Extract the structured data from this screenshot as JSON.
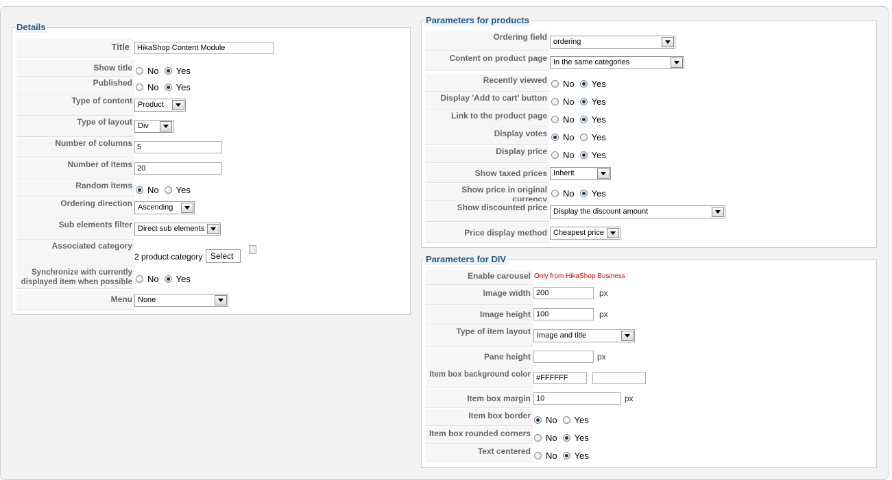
{
  "details": {
    "legend": "Details",
    "title_label": "Title",
    "title_value": "HikaShop Content Module",
    "show_title_label": "Show title",
    "published_label": "Published",
    "type_content_label": "Type of content",
    "type_content_value": "Product",
    "type_layout_label": "Type of layout",
    "type_layout_value": "Div",
    "num_columns_label": "Number of columns",
    "num_columns_value": "5",
    "num_items_label": "Number of items",
    "num_items_value": "20",
    "random_label": "Random items",
    "ordering_dir_label": "Ordering direction",
    "ordering_dir_value": "Ascending",
    "sub_filter_label": "Sub elements filter",
    "sub_filter_value": "Direct sub elements",
    "assoc_cat_label": "Associated category",
    "assoc_cat_value": "2 product category",
    "select_btn": "Select",
    "sync_label": "Synchronize with currently displayed item when possible",
    "menu_label": "Menu",
    "menu_value": "None"
  },
  "radio": {
    "no": "No",
    "yes": "Yes"
  },
  "products": {
    "legend": "Parameters for products",
    "ordering_field_label": "Ordering field",
    "ordering_field_value": "ordering",
    "content_page_label": "Content on product page",
    "content_page_value": "In the same categories",
    "recently_viewed_label": "Recently viewed",
    "add_cart_label": "Display 'Add to cart' button",
    "link_product_label": "Link to the product page",
    "votes_label": "Display votes",
    "price_label": "Display price",
    "taxed_label": "Show taxed prices",
    "taxed_value": "Inherit",
    "orig_currency_label": "Show price in original currency",
    "discounted_label": "Show discounted price",
    "discounted_value": "Display the discount amount",
    "price_method_label": "Price display method",
    "price_method_value": "Cheapest price"
  },
  "div": {
    "legend": "Parameters for DIV",
    "carousel_label": "Enable carousel",
    "carousel_note": "Only from HikaShop Business",
    "img_width_label": "Image width",
    "img_width_value": "200",
    "img_height_label": "Image height",
    "img_height_value": "100",
    "item_layout_label": "Type of item layout",
    "item_layout_value": "Image and title",
    "pane_height_label": "Pane height",
    "pane_height_value": "",
    "bg_color_label": "Item box background color",
    "bg_color_value": "#FFFFFF",
    "margin_label": "Item box margin",
    "margin_value": "10",
    "border_label": "Item box border",
    "rounded_label": "Item box rounded corners",
    "centered_label": "Text centered",
    "px": "px"
  }
}
